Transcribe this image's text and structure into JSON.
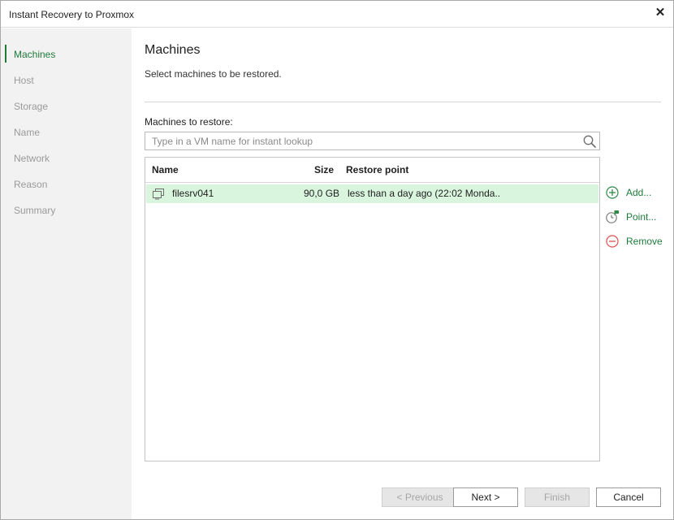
{
  "window": {
    "title": "Instant Recovery to Proxmox"
  },
  "sidebar": {
    "steps": [
      {
        "label": "Machines",
        "active": true
      },
      {
        "label": "Host",
        "active": false
      },
      {
        "label": "Storage",
        "active": false
      },
      {
        "label": "Name",
        "active": false
      },
      {
        "label": "Network",
        "active": false
      },
      {
        "label": "Reason",
        "active": false
      },
      {
        "label": "Summary",
        "active": false
      }
    ]
  },
  "main": {
    "title": "Machines",
    "subtitle": "Select machines to be restored.",
    "machines_label": "Machines to restore:",
    "search_placeholder": "Type in a VM name for instant lookup",
    "table": {
      "columns": [
        "Name",
        "Size",
        "Restore point"
      ],
      "rows": [
        {
          "name": "filesrv041",
          "size": "90,0 GB",
          "restore_point": "less than a day ago (22:02 Monda..",
          "selected": true
        }
      ]
    },
    "actions": {
      "add": "Add...",
      "point": "Point...",
      "remove": "Remove"
    }
  },
  "footer": {
    "previous": "< Previous",
    "next": "Next >",
    "finish": "Finish",
    "cancel": "Cancel"
  },
  "colors": {
    "accent_green": "#1f7a3a",
    "selected_row": "#d9f5de",
    "remove_red": "#d9534f"
  }
}
